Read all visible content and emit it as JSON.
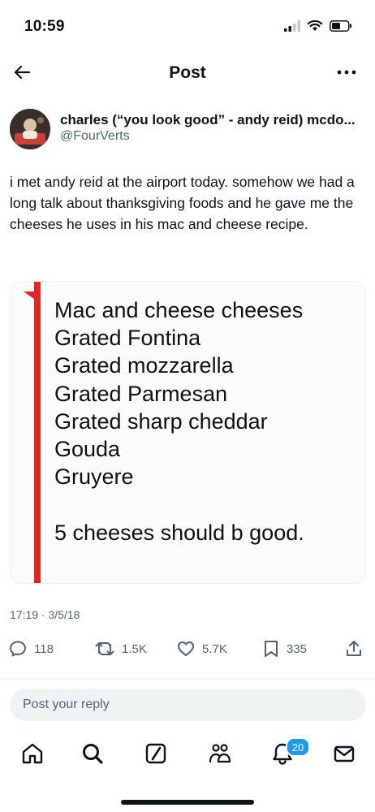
{
  "status_bar": {
    "time": "10:59"
  },
  "header": {
    "title": "Post"
  },
  "author": {
    "name": "charles (“you look good” - andy reid) mcdo...",
    "handle": "@FourVerts"
  },
  "post": {
    "text": "i met andy reid at the airport today. somehow we had a long talk about thanksgiving foods and he gave me the cheeses he uses in his mac and cheese recipe.",
    "media": {
      "lines": [
        "Mac and cheese cheeses",
        "Grated Fontina",
        "Grated mozzarella",
        "Grated Parmesan",
        "Grated sharp cheddar",
        "Gouda",
        "Gruyere"
      ],
      "closing": "5 cheeses should b good."
    },
    "timestamp": "17:19 · 3/5/18"
  },
  "actions": {
    "replies": "118",
    "reposts": "1.5K",
    "likes": "5.7K",
    "bookmarks": "335"
  },
  "reply": {
    "placeholder": "Post your reply"
  },
  "tab_bar": {
    "notification_count": "20"
  },
  "colors": {
    "accent": "#1d9bf0",
    "note_margin": "#e52521",
    "secondary_text": "#536471"
  }
}
